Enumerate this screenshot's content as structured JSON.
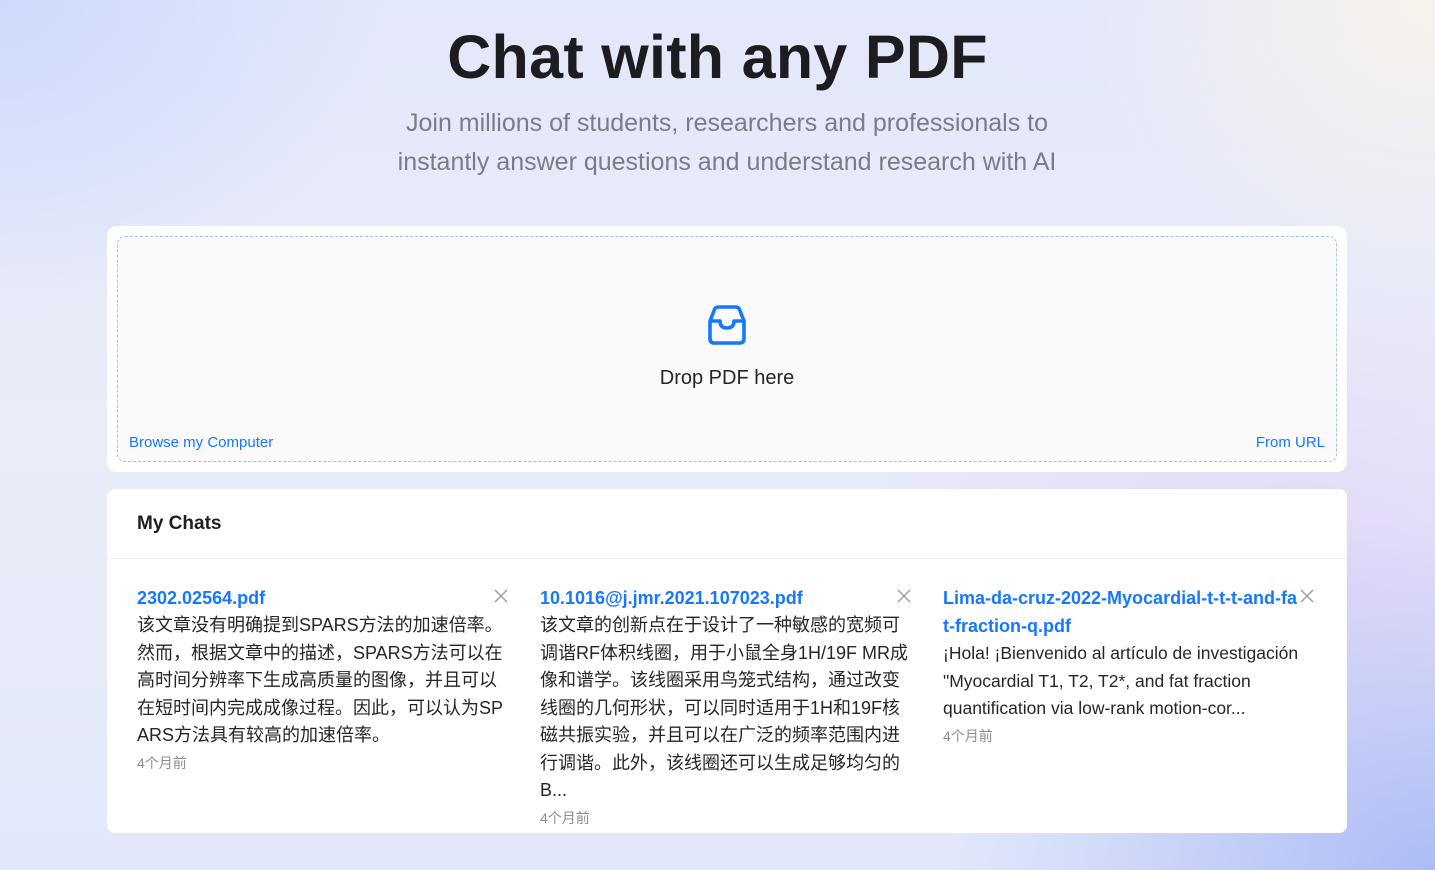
{
  "hero": {
    "title": "Chat with any PDF",
    "subtitle": "Join millions of students, researchers and professionals to instantly answer questions and understand research with AI"
  },
  "upload": {
    "icon": "inbox-icon",
    "drop_label": "Drop PDF here",
    "browse_label": "Browse my Computer",
    "url_label": "From URL",
    "accent_color": "#1677ff"
  },
  "chats": {
    "title": "My Chats",
    "items": [
      {
        "name": "2302.02564.pdf",
        "preview": "该文章没有明确提到SPARS方法的加速倍率。然而，根据文章中的描述，SPARS方法可以在高时间分辨率下生成高质量的图像，并且可以在短时间内完成成像过程。因此，可以认为SPARS方法具有较高的加速倍率。",
        "time": "4个月前"
      },
      {
        "name": "10.1016@j.jmr.2021.107023.pdf",
        "preview": "该文章的创新点在于设计了一种敏感的宽频可调谐RF体积线圈，用于小鼠全身1H/19F MR成像和谱学。该线圈采用鸟笼式结构，通过改变线圈的几何形状，可以同时适用于1H和19F核磁共振实验，并且可以在广泛的频率范围内进行调谐。此外，该线圈还可以生成足够均匀的B...",
        "time": "4个月前"
      },
      {
        "name": "Lima-da-cruz-2022-Myocardial-t-t-t-and-fat-fraction-q.pdf",
        "preview": "¡Hola! ¡Bienvenido al artículo de investigación \"Myocardial T1, T2, T2*, and fat fraction quantification via low-rank motion-cor...",
        "time": "4个月前"
      }
    ]
  }
}
